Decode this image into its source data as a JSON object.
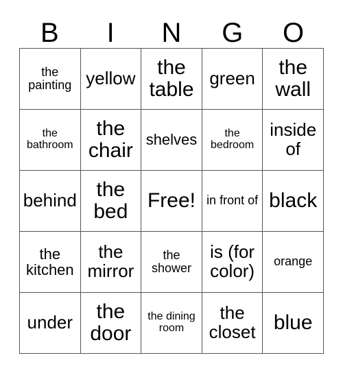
{
  "card": {
    "title": "BINGO",
    "columns": [
      "B",
      "I",
      "N",
      "G",
      "O"
    ],
    "border_color": "#555555",
    "text_color": "#000000",
    "background_color": "#ffffff",
    "rows": 5,
    "cols": 5,
    "free_space": "Free!",
    "cells": [
      [
        {
          "text": "the painting",
          "size": "sm"
        },
        {
          "text": "yellow",
          "size": "lg"
        },
        {
          "text": "the table",
          "size": "xl"
        },
        {
          "text": "green",
          "size": "lg"
        },
        {
          "text": "the wall",
          "size": "xl"
        }
      ],
      [
        {
          "text": "the bathroom",
          "size": "xs"
        },
        {
          "text": "the chair",
          "size": "xl"
        },
        {
          "text": "shelves",
          "size": "md"
        },
        {
          "text": "the bedroom",
          "size": "xs"
        },
        {
          "text": "inside of",
          "size": "lg"
        }
      ],
      [
        {
          "text": "behind",
          "size": "lg"
        },
        {
          "text": "the bed",
          "size": "xl"
        },
        {
          "text": "Free!",
          "size": "xl"
        },
        {
          "text": "in front of",
          "size": "sm"
        },
        {
          "text": "black",
          "size": "xl"
        }
      ],
      [
        {
          "text": "the kitchen",
          "size": "md"
        },
        {
          "text": "the mirror",
          "size": "lg"
        },
        {
          "text": "the shower",
          "size": "sm"
        },
        {
          "text": "is (for color)",
          "size": "lg"
        },
        {
          "text": "orange",
          "size": "sm"
        }
      ],
      [
        {
          "text": "under",
          "size": "lg"
        },
        {
          "text": "the door",
          "size": "xl"
        },
        {
          "text": "the dining room",
          "size": "xs"
        },
        {
          "text": "the closet",
          "size": "lg"
        },
        {
          "text": "blue",
          "size": "xl"
        }
      ]
    ]
  }
}
